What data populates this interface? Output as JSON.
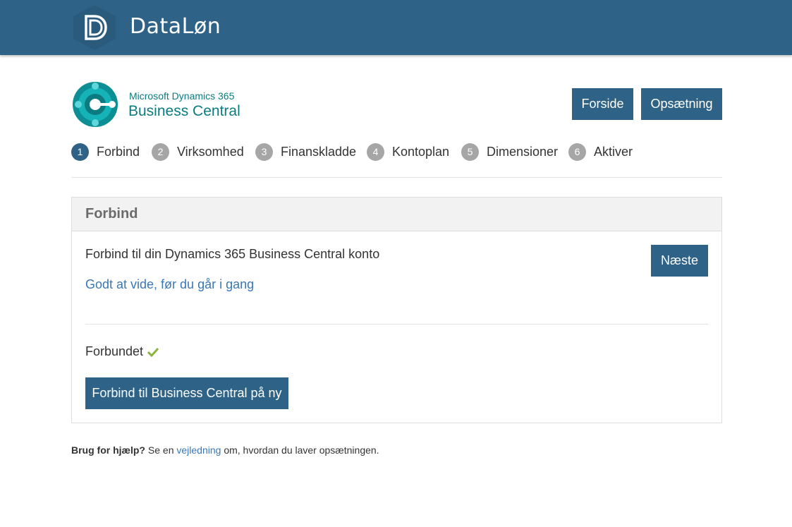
{
  "header": {
    "brand_name": "DataLøn",
    "logo_icon": "dataloen-d-icon",
    "bg_color": "#2e6387"
  },
  "product": {
    "logo_icon": "business-central-icon",
    "line1": "Microsoft Dynamics 365",
    "line2": "Business Central"
  },
  "nav": {
    "home_label": "Forside",
    "setup_label": "Opsætning"
  },
  "steps": [
    {
      "num": "1",
      "label": "Forbind",
      "active": true
    },
    {
      "num": "2",
      "label": "Virksomhed",
      "active": false
    },
    {
      "num": "3",
      "label": "Finanskladde",
      "active": false
    },
    {
      "num": "4",
      "label": "Kontoplan",
      "active": false
    },
    {
      "num": "5",
      "label": "Dimensioner",
      "active": false
    },
    {
      "num": "6",
      "label": "Aktiver",
      "active": false
    }
  ],
  "panel": {
    "title": "Forbind",
    "intro": "Forbind til din Dynamics 365 Business Central konto",
    "info_link": "Godt at vide, før du går i gang",
    "next_label": "Næste",
    "status_text": "Forbundet",
    "status_icon": "checkmark-icon",
    "status_color": "#8ab43c",
    "reconnect_label": "Forbind til Business Central på ny"
  },
  "help": {
    "bold": "Brug for hjælp?",
    "pre": " Se en ",
    "link": "vejledning",
    "post": " om, hvordan du laver opsætningen."
  },
  "colors": {
    "accent": "#2e6387",
    "link": "#3a77b8",
    "inactive_step": "#a6a6a6",
    "teal": "#0b7b80"
  }
}
